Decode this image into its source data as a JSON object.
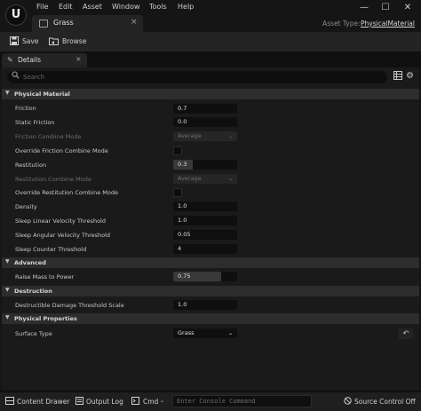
{
  "menu": {
    "items": [
      "File",
      "Edit",
      "Asset",
      "Window",
      "Tools",
      "Help"
    ]
  },
  "window_controls": {
    "minimize": "—",
    "maximize": "☐",
    "close": "✕"
  },
  "asset_tab": {
    "label": "Grass",
    "close": "×"
  },
  "asset_type": {
    "label": "Asset Type:",
    "value": "PhysicalMaterial"
  },
  "toolbar": {
    "save_label": "Save",
    "browse_label": "Browse"
  },
  "details_tab": {
    "label": "Details",
    "close": "×"
  },
  "search": {
    "placeholder": "Search"
  },
  "sections": {
    "physical_material": "Physical Material",
    "advanced": "Advanced",
    "destruction": "Destruction",
    "physical_properties": "Physical Properties"
  },
  "properties": {
    "friction": {
      "label": "Friction",
      "value": "0.7"
    },
    "static_friction": {
      "label": "Static Friction",
      "value": "0.0"
    },
    "friction_combine_mode": {
      "label": "Friction Combine Mode",
      "value": "Average"
    },
    "override_friction_combine_mode": {
      "label": "Override Friction Combine Mode",
      "checked": false
    },
    "restitution": {
      "label": "Restitution",
      "value": "0.3",
      "fraction": 0.3
    },
    "restitution_combine_mode": {
      "label": "Restitution Combine Mode",
      "value": "Average"
    },
    "override_restitution_combine_mode": {
      "label": "Override Restitution Combine Mode",
      "checked": false
    },
    "density": {
      "label": "Density",
      "value": "1.0"
    },
    "sleep_linear_velocity_threshold": {
      "label": "Sleep Linear Velocity Threshold",
      "value": "1.0"
    },
    "sleep_angular_velocity_threshold": {
      "label": "Sleep Angular Velocity Threshold",
      "value": "0.05"
    },
    "sleep_counter_threshold": {
      "label": "Sleep Counter Threshold",
      "value": "4"
    },
    "raise_mass_to_power": {
      "label": "Raise Mass to Power",
      "value": "0.75",
      "fraction": 0.75
    },
    "destructible_damage_threshold_scale": {
      "label": "Destructible Damage Threshold Scale",
      "value": "1.0"
    },
    "surface_type": {
      "label": "Surface Type",
      "value": "Grass"
    }
  },
  "statusbar": {
    "content_drawer": "Content Drawer",
    "output_log": "Output Log",
    "cmd": "Cmd",
    "console_placeholder": "Enter Console Command",
    "source_control": "Source Control Off"
  },
  "icons": {
    "logo": "unreal-logo-icon",
    "save": "save-icon",
    "browse": "folder-icon",
    "details": "pencil-icon",
    "search": "search-icon",
    "grid": "grid-icon",
    "settings": "gear-icon",
    "reset": "reset-arrow-icon"
  }
}
